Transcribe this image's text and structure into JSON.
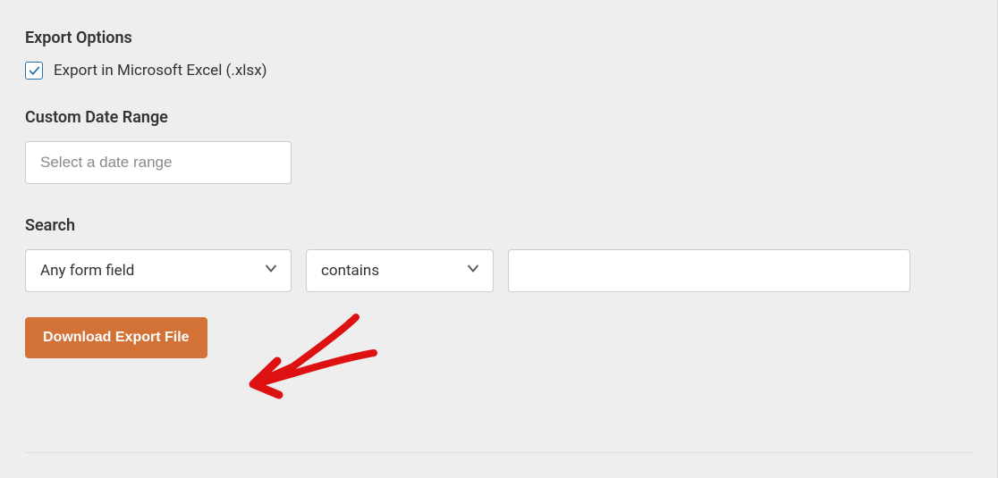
{
  "export_options": {
    "heading": "Export Options",
    "checkbox_label": "Export in Microsoft Excel (.xlsx)",
    "checked": true
  },
  "date_range": {
    "heading": "Custom Date Range",
    "placeholder": "Select a date range",
    "value": ""
  },
  "search": {
    "heading": "Search",
    "field_select": "Any form field",
    "operator_select": "contains",
    "search_value": ""
  },
  "download_button": "Download Export File"
}
